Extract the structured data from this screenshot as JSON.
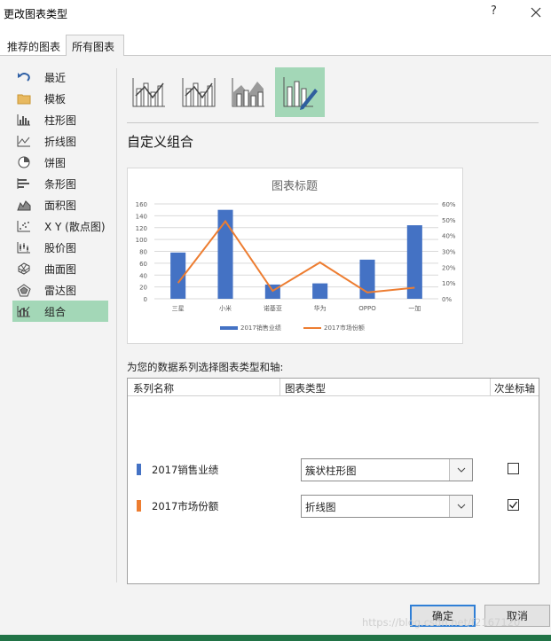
{
  "window": {
    "title": "更改图表类型",
    "help": "?",
    "close_icon": "close-icon"
  },
  "tabs": [
    {
      "label": "推荐的图表"
    },
    {
      "label": "所有图表",
      "active": true
    }
  ],
  "sidebar": {
    "items": [
      {
        "label": "最近",
        "icon": "undo-arrow-icon"
      },
      {
        "label": "模板",
        "icon": "folder-icon"
      },
      {
        "label": "柱形图",
        "icon": "column-chart-icon"
      },
      {
        "label": "折线图",
        "icon": "line-chart-icon"
      },
      {
        "label": "饼图",
        "icon": "pie-chart-icon"
      },
      {
        "label": "条形图",
        "icon": "bar-chart-icon"
      },
      {
        "label": "面积图",
        "icon": "area-chart-icon"
      },
      {
        "label": "X Y (散点图)",
        "icon": "scatter-chart-icon"
      },
      {
        "label": "股价图",
        "icon": "stock-chart-icon"
      },
      {
        "label": "曲面图",
        "icon": "surface-chart-icon"
      },
      {
        "label": "雷达图",
        "icon": "radar-chart-icon"
      },
      {
        "label": "组合",
        "icon": "combo-chart-icon",
        "selected": true
      }
    ]
  },
  "combo_types": [
    {
      "icon": "column-line-combo-icon"
    },
    {
      "icon": "column-line-secondary-axis-icon"
    },
    {
      "icon": "stacked-area-column-icon"
    },
    {
      "icon": "custom-combo-icon",
      "selected": true
    }
  ],
  "section": {
    "title": "自定义组合"
  },
  "chart_data": {
    "type": "bar",
    "title": "图表标题",
    "categories": [
      "三星",
      "小米",
      "诺基亚",
      "华为",
      "OPPO",
      "一加"
    ],
    "series": [
      {
        "name": "2017销售业绩",
        "type": "bar",
        "axis": "primary",
        "color": "#4472c4",
        "values": [
          78,
          150,
          24,
          26,
          66,
          124
        ]
      },
      {
        "name": "2017市场份额",
        "type": "line",
        "axis": "secondary",
        "color": "#ed7d31",
        "values": [
          0.1,
          0.49,
          0.05,
          0.23,
          0.04,
          0.07
        ]
      }
    ],
    "y_primary": {
      "range": [
        0,
        160
      ],
      "ticks": [
        "0",
        "20",
        "40",
        "60",
        "80",
        "100",
        "120",
        "140",
        "160"
      ]
    },
    "y_secondary": {
      "range": [
        0,
        0.6
      ],
      "ticks": [
        "0%",
        "10%",
        "20%",
        "30%",
        "40%",
        "50%",
        "60%"
      ]
    },
    "grid": true,
    "legend": "bottom"
  },
  "assign": {
    "label": "为您的数据系列选择图表类型和轴:",
    "headers": {
      "name": "系列名称",
      "type": "图表类型",
      "secondary": "次坐标轴"
    },
    "rows": [
      {
        "name": "2017销售业绩",
        "color": "#4472c4",
        "chart_type": "簇状柱形图",
        "secondary": false
      },
      {
        "name": "2017市场份额",
        "color": "#ed7d31",
        "chart_type": "折线图",
        "secondary": true
      }
    ]
  },
  "footer": {
    "ok": "确定",
    "cancel": "取消"
  },
  "watermark": "https://blog.csdn.net/f2167120"
}
